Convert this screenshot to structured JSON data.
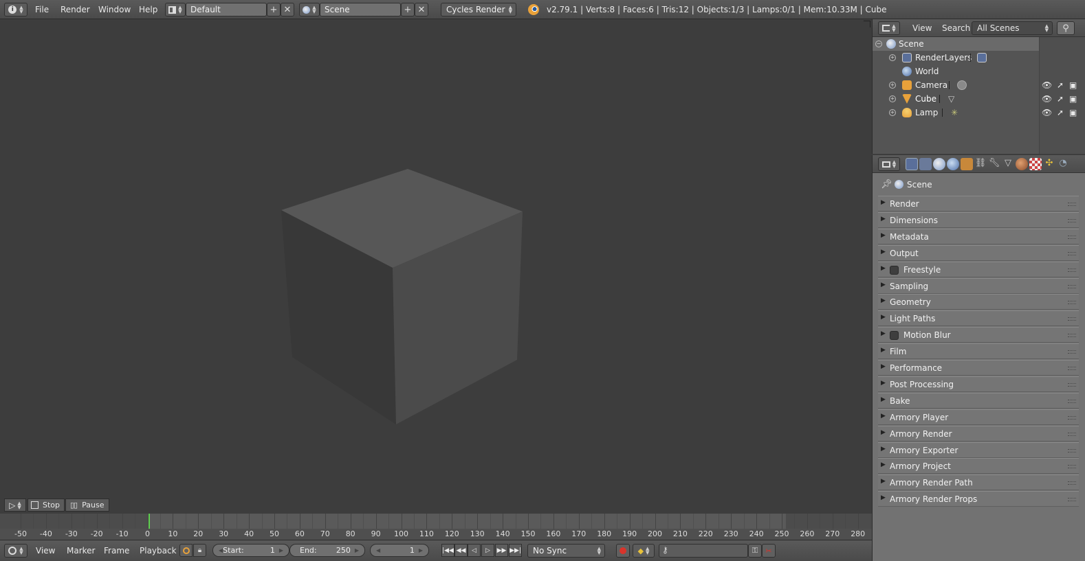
{
  "topbar": {
    "menus": [
      "File",
      "Render",
      "Window",
      "Help"
    ],
    "layout_name": "Default",
    "scene_name": "Scene",
    "render_engine": "Cycles Render",
    "stats": "v2.79.1 | Verts:8 | Faces:6 | Tris:12 | Objects:1/3 | Lamps:0/1 | Mem:10.33M | Cube"
  },
  "viewport": {
    "object": "Cube"
  },
  "playback_strip": {
    "stop_label": "Stop",
    "pause_label": "Pause"
  },
  "timeline": {
    "ticks": [
      "-50",
      "-40",
      "-30",
      "-20",
      "-10",
      "0",
      "10",
      "20",
      "30",
      "40",
      "50",
      "60",
      "70",
      "80",
      "90",
      "100",
      "110",
      "120",
      "130",
      "140",
      "150",
      "160",
      "170",
      "180",
      "190",
      "200",
      "210",
      "220",
      "230",
      "240",
      "250",
      "260",
      "270",
      "280"
    ],
    "current_frame": 1
  },
  "bottombar": {
    "menus": [
      "View",
      "Marker",
      "Frame",
      "Playback"
    ],
    "start_label": "Start:",
    "start_value": "1",
    "end_label": "End:",
    "end_value": "250",
    "current_value": "1",
    "sync": "No Sync"
  },
  "outliner": {
    "menus": [
      "View",
      "Search"
    ],
    "filter": "All Scenes",
    "rows": [
      {
        "label": "Scene",
        "icon": "scene-icon"
      },
      {
        "label": "RenderLayers",
        "icon": "render-layers-icon"
      },
      {
        "label": "World",
        "icon": "world-icon"
      },
      {
        "label": "Camera",
        "icon": "camera-icon"
      },
      {
        "label": "Cube",
        "icon": "mesh-icon"
      },
      {
        "label": "Lamp",
        "icon": "lamp-icon"
      }
    ]
  },
  "properties": {
    "context_label": "Scene",
    "panels": [
      {
        "label": "Render",
        "checkbox": false
      },
      {
        "label": "Dimensions",
        "checkbox": false
      },
      {
        "label": "Metadata",
        "checkbox": false
      },
      {
        "label": "Output",
        "checkbox": false
      },
      {
        "label": "Freestyle",
        "checkbox": true
      },
      {
        "label": "Sampling",
        "checkbox": false
      },
      {
        "label": "Geometry",
        "checkbox": false
      },
      {
        "label": "Light Paths",
        "checkbox": false
      },
      {
        "label": "Motion Blur",
        "checkbox": true
      },
      {
        "label": "Film",
        "checkbox": false
      },
      {
        "label": "Performance",
        "checkbox": false
      },
      {
        "label": "Post Processing",
        "checkbox": false
      },
      {
        "label": "Bake",
        "checkbox": false
      },
      {
        "label": "Armory Player",
        "checkbox": false
      },
      {
        "label": "Armory Render",
        "checkbox": false
      },
      {
        "label": "Armory Exporter",
        "checkbox": false
      },
      {
        "label": "Armory Project",
        "checkbox": false
      },
      {
        "label": "Armory Render Path",
        "checkbox": false
      },
      {
        "label": "Armory Render Props",
        "checkbox": false
      }
    ]
  },
  "colors": {
    "accent_orange": "#e8a13a",
    "timeline_cursor": "#5fd04f",
    "selection": "#c8c8c8"
  }
}
